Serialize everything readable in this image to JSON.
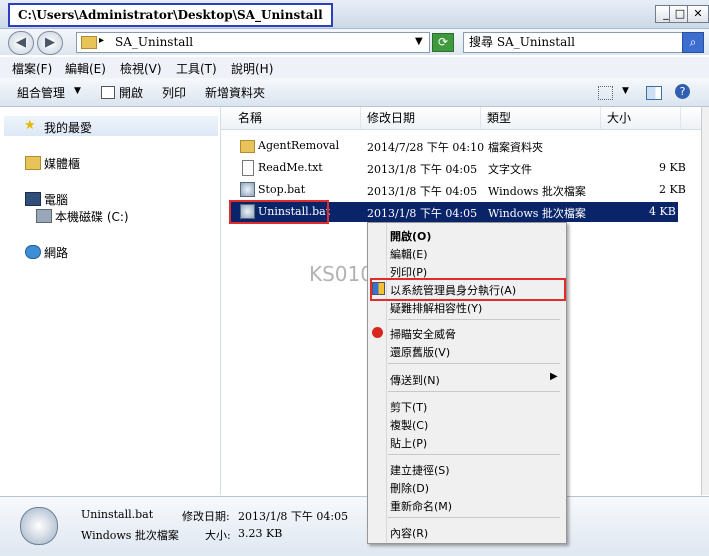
{
  "window": {
    "title": "C:\\Users\\Administrator\\Desktop\\SA_Uninstall",
    "controls": {
      "minimize": "_",
      "maximize": "□",
      "close": "✕"
    }
  },
  "address": {
    "path": "SA_Uninstall",
    "search_placeholder": "搜尋 SA_Uninstall"
  },
  "menubar": [
    "檔案(F)",
    "編輯(E)",
    "檢視(V)",
    "工具(T)",
    "說明(H)"
  ],
  "toolbar": {
    "organize": "組合管理",
    "open": "開啟",
    "print": "列印",
    "new_folder": "新增資料夾"
  },
  "nav": {
    "favorites": "我的最愛",
    "libraries": "媒體櫃",
    "computer": "電腦",
    "local_disk": "本機磁碟 (C:)",
    "network": "網路"
  },
  "columns": {
    "name": "名稱",
    "modified": "修改日期",
    "type": "類型",
    "size": "大小"
  },
  "files": [
    {
      "name": "AgentRemoval",
      "modified": "2014/7/28 下午 04:10",
      "type": "檔案資料夾",
      "size": "",
      "icon": "folder-icon"
    },
    {
      "name": "ReadMe.txt",
      "modified": "2013/1/8 下午 04:05",
      "type": "文字文件",
      "size": "9 KB",
      "icon": "text-file-icon"
    },
    {
      "name": "Stop.bat",
      "modified": "2013/1/8 下午 04:05",
      "type": "Windows 批次檔案",
      "size": "2 KB",
      "icon": "batch-file-icon"
    },
    {
      "name": "Uninstall.bat",
      "modified": "2013/1/8 下午 04:05",
      "type": "Windows 批次檔案",
      "size": "4 KB",
      "icon": "batch-file-icon"
    }
  ],
  "context_menu": {
    "open": "開啟(O)",
    "edit": "編輯(E)",
    "print": "列印(P)",
    "run_as_admin": "以系統管理員身分執行(A)",
    "troubleshoot": "疑難排解相容性(Y)",
    "scan": "掃瞄安全威脅",
    "restore": "還原舊版(V)",
    "send_to": "傳送到(N)",
    "cut": "剪下(T)",
    "copy": "複製(C)",
    "paste": "貼上(P)",
    "shortcut": "建立捷徑(S)",
    "delete": "刪除(D)",
    "rename": "重新命名(M)",
    "properties": "內容(R)"
  },
  "details": {
    "name": "Uninstall.bat",
    "modified_label": "修改日期:",
    "modified": "2013/1/8 下午 04:05",
    "type": "Windows 批次檔案",
    "size_label": "大小:",
    "size": "3.23 KB"
  },
  "watermark": "KS010S",
  "colors": {
    "selection": "#0a246a",
    "highlight_box": "#e22b2b",
    "title_box": "#2b3fbf"
  }
}
